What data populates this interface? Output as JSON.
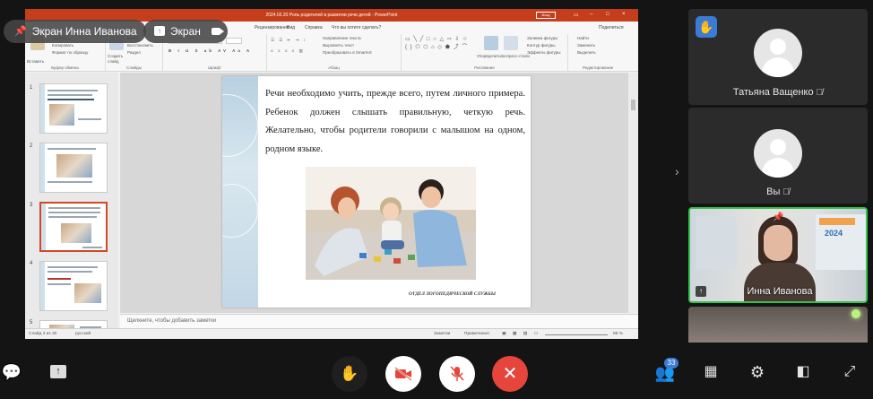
{
  "presenter_badge": {
    "label": "Экран Инна Иванова"
  },
  "screen_badge": {
    "label": "Экран"
  },
  "powerpoint": {
    "title": "2024.02.20 Роль родителей в развитии речи детей - PowerPoint",
    "signin": "Вход",
    "tabs": [
      "Рецензирование",
      "Вид",
      "Справка",
      "Что вы хотите сделать?",
      "Поделиться"
    ],
    "groups": {
      "clipboard": {
        "label": "Буфер обмена",
        "lines": [
          "Вырезать",
          "Копировать",
          "Формат по образцу"
        ],
        "paste": "Вставить"
      },
      "slides": {
        "label": "Слайды",
        "lines": [
          "Макет",
          "Восстановить",
          "Раздел"
        ],
        "create": "Создать слайд"
      },
      "font": {
        "label": "Шрифт"
      },
      "paragraph": {
        "label": "Абзац",
        "lines": [
          "Направление текста",
          "Выровнять текст",
          "Преобразовать в SmartArt"
        ]
      },
      "drawing": {
        "label": "Рисование",
        "arrange": "Упорядочить",
        "styles": "Экспресс-стили",
        "lines": [
          "Заливка фигуры",
          "Контур фигуры",
          "Эффекты фигуры"
        ]
      },
      "editing": {
        "label": "Редактирование",
        "lines": [
          "Найти",
          "Заменить",
          "Выделить"
        ]
      }
    },
    "thumbnails": [
      {
        "num": "1"
      },
      {
        "num": "2"
      },
      {
        "num": "3"
      },
      {
        "num": "4"
      },
      {
        "num": "5"
      }
    ],
    "slide": {
      "body": "Речи необходимо учить, прежде всего, путем личного примера. Ребенок должен слышать правильную, четкую речь. Желательно, чтобы родители говорили с малышом на одном, родном языке.",
      "caption": "ОТДЕЛ ЛОГОПЕДИЧЕСКОЙ СЛУЖБЫ"
    },
    "notes_placeholder": "Щелкните, чтобы добавить заметки",
    "status": {
      "slide_info": "Слайд 3 из 30",
      "language": "русский",
      "notes": "Заметки",
      "comments": "Примечания",
      "zoom": "85 %"
    }
  },
  "participants": [
    {
      "name": "Татьяна Ващенко",
      "muted": true
    },
    {
      "name": "Вы",
      "muted": true
    },
    {
      "name": "Инна Иванова",
      "muted": false,
      "active_speaker": true
    }
  ],
  "inna_banner_number": "2024",
  "toolbar": {
    "participants_count": "33"
  },
  "colors": {
    "ppt_red": "#c43e1c",
    "end_call": "#e5453b",
    "active_border": "#32c24d",
    "accent_blue": "#3a7bd5"
  }
}
